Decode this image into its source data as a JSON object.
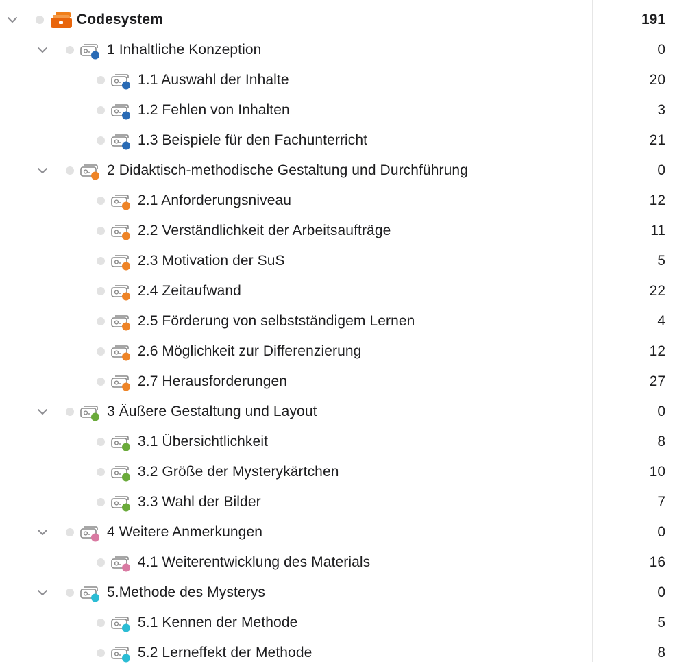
{
  "root": {
    "label": "Codesystem",
    "count": "191",
    "icon": "codesystem-folder-icon",
    "color": "#f07f1a"
  },
  "rows": [
    {
      "level": 1,
      "expandable": true,
      "label": "1 Inhaltliche Konzeption",
      "count": "0",
      "color": "#2a6bb5"
    },
    {
      "level": 2,
      "expandable": false,
      "label": "1.1 Auswahl der Inhalte",
      "count": "20",
      "color": "#2a6bb5"
    },
    {
      "level": 2,
      "expandable": false,
      "label": "1.2 Fehlen von Inhalten",
      "count": "3",
      "color": "#2a6bb5"
    },
    {
      "level": 2,
      "expandable": false,
      "label": "1.3 Beispiele für den Fachunterricht",
      "count": "21",
      "color": "#2a6bb5"
    },
    {
      "level": 1,
      "expandable": true,
      "label": "2 Didaktisch-methodische Gestaltung und Durchführung",
      "count": "0",
      "color": "#ee8427"
    },
    {
      "level": 2,
      "expandable": false,
      "label": "2.1 Anforderungsniveau",
      "count": "12",
      "color": "#ee8427"
    },
    {
      "level": 2,
      "expandable": false,
      "label": "2.2 Verständlichkeit der Arbeitsaufträge",
      "count": "11",
      "color": "#ee8427"
    },
    {
      "level": 2,
      "expandable": false,
      "label": "2.3 Motivation der SuS",
      "count": "5",
      "color": "#ee8427"
    },
    {
      "level": 2,
      "expandable": false,
      "label": "2.4 Zeitaufwand",
      "count": "22",
      "color": "#ee8427"
    },
    {
      "level": 2,
      "expandable": false,
      "label": "2.5 Förderung von selbstständigem Lernen",
      "count": "4",
      "color": "#ee8427"
    },
    {
      "level": 2,
      "expandable": false,
      "label": "2.6 Möglichkeit zur Differenzierung",
      "count": "12",
      "color": "#ee8427"
    },
    {
      "level": 2,
      "expandable": false,
      "label": "2.7 Herausforderungen",
      "count": "27",
      "color": "#ee8427"
    },
    {
      "level": 1,
      "expandable": true,
      "label": "3 Äußere Gestaltung und Layout",
      "count": "0",
      "color": "#6aaa3a"
    },
    {
      "level": 2,
      "expandable": false,
      "label": "3.1 Übersichtlichkeit",
      "count": "8",
      "color": "#6aaa3a"
    },
    {
      "level": 2,
      "expandable": false,
      "label": "3.2 Größe der Mysterykärtchen",
      "count": "10",
      "color": "#6aaa3a"
    },
    {
      "level": 2,
      "expandable": false,
      "label": "3.3 Wahl der Bilder",
      "count": "7",
      "color": "#6aaa3a"
    },
    {
      "level": 1,
      "expandable": true,
      "label": "4 Weitere Anmerkungen",
      "count": "0",
      "color": "#d97aa2"
    },
    {
      "level": 2,
      "expandable": false,
      "label": "4.1 Weiterentwicklung des Materials",
      "count": "16",
      "color": "#d97aa2"
    },
    {
      "level": 1,
      "expandable": true,
      "label": "5.Methode des Mysterys",
      "count": "0",
      "color": "#2bbcd4"
    },
    {
      "level": 2,
      "expandable": false,
      "label": "5.1 Kennen der Methode",
      "count": "5",
      "color": "#2bbcd4"
    },
    {
      "level": 2,
      "expandable": false,
      "label": "5.2 Lerneffekt der Methode",
      "count": "8",
      "color": "#2bbcd4"
    }
  ]
}
